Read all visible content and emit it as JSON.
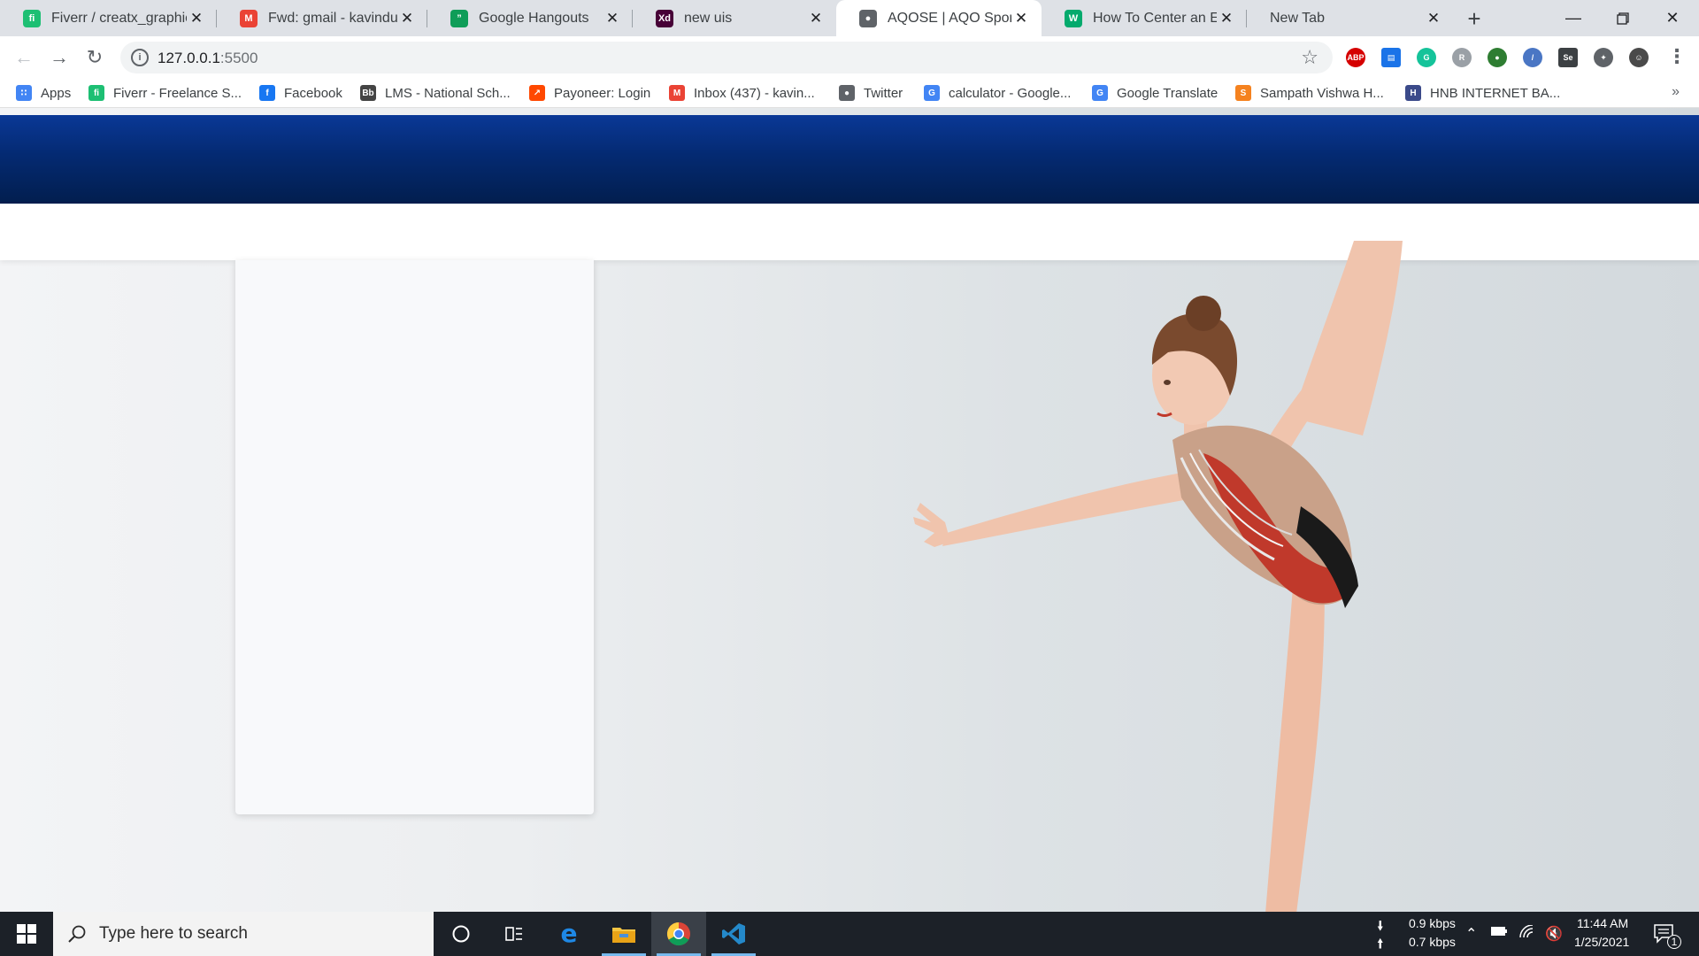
{
  "browser": {
    "tabs": [
      {
        "label": "Fiverr / creatx_graphic",
        "favicon": "fiverr-icon",
        "color": "#1dbf73",
        "glyph": "fi"
      },
      {
        "label": "Fwd: gmail - kavinduth",
        "favicon": "gmail-icon",
        "color": "#ea4335",
        "glyph": "M"
      },
      {
        "label": "Google Hangouts",
        "favicon": "hangouts-icon",
        "color": "#0f9d58",
        "glyph": "”"
      },
      {
        "label": "new uis",
        "favicon": "adobe-xd-icon",
        "color": "#470137",
        "glyph": "Xd"
      },
      {
        "label": "AQOSE | AQO Sports &",
        "favicon": "globe-icon",
        "color": "#5f6368",
        "glyph": "●"
      },
      {
        "label": "How To Center an Elem",
        "favicon": "w3schools-icon",
        "color": "#04aa6d",
        "glyph": "W"
      },
      {
        "label": "New Tab",
        "favicon": "",
        "color": "",
        "glyph": ""
      }
    ],
    "active_tab_index": 4,
    "url_host": "127.0.0.1",
    "url_port": ":5500",
    "bookmarks": [
      {
        "label": "Apps",
        "icon": "apps-grid-icon",
        "color": "#4285f4",
        "glyph": "∷"
      },
      {
        "label": "Fiverr - Freelance S...",
        "icon": "fiverr-icon",
        "color": "#1dbf73",
        "glyph": "fi"
      },
      {
        "label": "Facebook",
        "icon": "facebook-icon",
        "color": "#1877f2",
        "glyph": "f"
      },
      {
        "label": "LMS - National Sch...",
        "icon": "blackboard-icon",
        "color": "#444444",
        "glyph": "Bb"
      },
      {
        "label": "Payoneer: Login",
        "icon": "payoneer-icon",
        "color": "#ff4800",
        "glyph": "↗"
      },
      {
        "label": "Inbox (437) - kavin...",
        "icon": "gmail-icon",
        "color": "#ea4335",
        "glyph": "M"
      },
      {
        "label": "Twitter",
        "icon": "globe-icon",
        "color": "#5f6368",
        "glyph": "●"
      },
      {
        "label": "calculator - Google...",
        "icon": "google-icon",
        "color": "#4285f4",
        "glyph": "G"
      },
      {
        "label": "Google Translate",
        "icon": "google-translate-icon",
        "color": "#4285f4",
        "glyph": "G"
      },
      {
        "label": "Sampath Vishwa H...",
        "icon": "sampath-icon",
        "color": "#f5821f",
        "glyph": "S"
      },
      {
        "label": "HNB INTERNET BA...",
        "icon": "hnb-icon",
        "color": "#3b4a8a",
        "glyph": "H"
      }
    ],
    "extensions": [
      {
        "name": "adblock-plus-icon",
        "color": "#d50000",
        "glyph": "ABP"
      },
      {
        "name": "tab-manager-icon",
        "color": "#1a73e8",
        "glyph": "▤"
      },
      {
        "name": "grammarly-icon",
        "color": "#15c39a",
        "glyph": "G"
      },
      {
        "name": "extension-gray-icon",
        "color": "#9aa0a6",
        "glyph": "R"
      },
      {
        "name": "earth-icon",
        "color": "#2e7d32",
        "glyph": "●"
      },
      {
        "name": "feather-icon",
        "color": "#4a76c4",
        "glyph": "/"
      },
      {
        "name": "selenium-icon",
        "color": "#3c4043",
        "glyph": "Se"
      },
      {
        "name": "puzzle-icon",
        "color": "#5f6368",
        "glyph": "✦"
      },
      {
        "name": "profile-avatar-icon",
        "color": "#4a4a4a",
        "glyph": "☺"
      }
    ]
  },
  "colors": {
    "banner_top": "#0a3896",
    "banner_bottom": "#021e4e",
    "card": "#f8f9fb",
    "taskbar": "#1c2128",
    "taskbar_accent": "#76b9ed"
  },
  "taskbar": {
    "search_placeholder": "Type here to search",
    "apps": [
      "cortana-icon",
      "task-view-icon",
      "edge-icon",
      "file-explorer-icon",
      "chrome-icon",
      "vscode-icon"
    ],
    "net_down": "0.9 kbps",
    "net_up": "0.7 kbps",
    "time": "11:44 AM",
    "date": "1/25/2021",
    "notification_count": "1"
  }
}
